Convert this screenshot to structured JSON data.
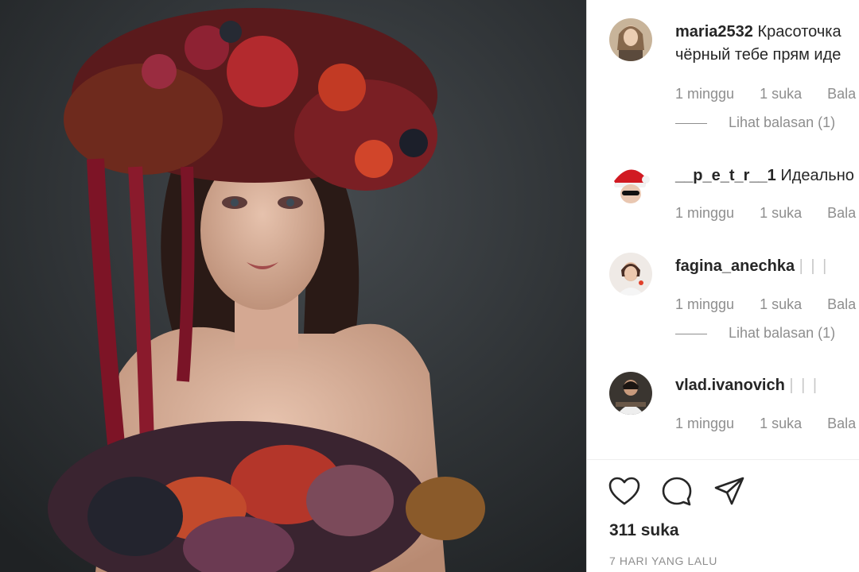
{
  "post": {
    "photo_icon": "portrait-photo",
    "likes": "311 suka",
    "timestamp": "7 HARI YANG LALU",
    "actions": [
      "heart-icon",
      "comment-icon",
      "share-icon"
    ]
  },
  "comments": [
    {
      "username": "maria2532",
      "text_line1": "Красоточка",
      "text_line2": "чёрный тебе прям иде",
      "time": "1 minggu",
      "likes": "1 suka",
      "reply": "Bala",
      "view_replies": "Lihat balasan (1)"
    },
    {
      "username": "__p_e_t_r__1",
      "text_line1": "Идеально",
      "time": "1 minggu",
      "likes": "1 suka",
      "reply": "Bala"
    },
    {
      "username": "fagina_anechka",
      "text_line1": "| | |",
      "time": "1 minggu",
      "likes": "1 suka",
      "reply": "Bala",
      "view_replies": "Lihat balasan (1)"
    },
    {
      "username": "vlad.ivanovich",
      "text_line1": "| | |",
      "time": "1 minggu",
      "likes": "1 suka",
      "reply": "Bala"
    }
  ],
  "colors": {
    "text": "#262626",
    "muted": "#8e8e8e",
    "divider": "#dbdbdb"
  }
}
